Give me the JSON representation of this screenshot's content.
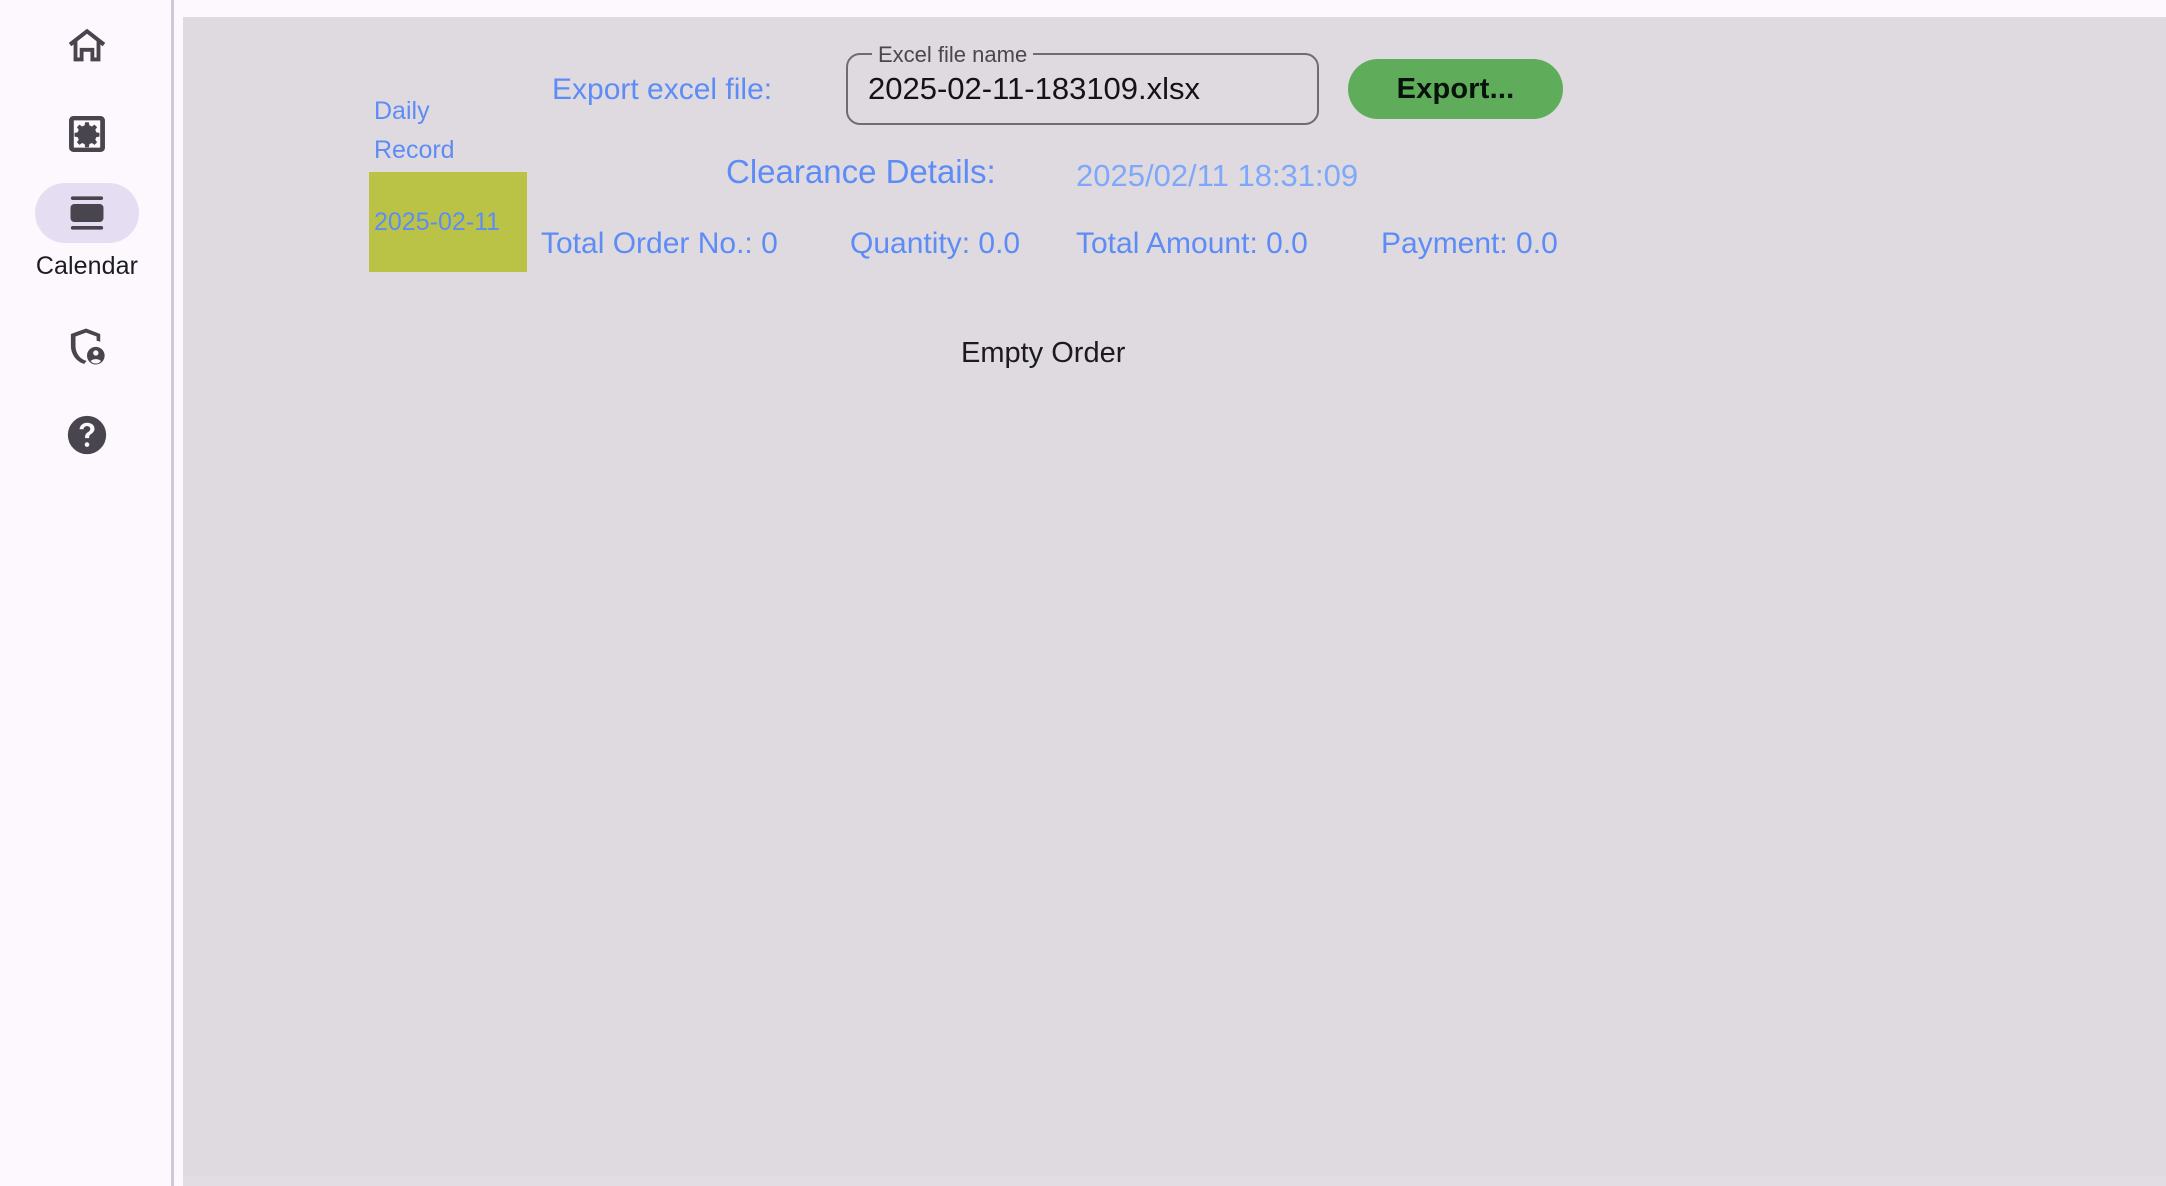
{
  "sidebar": {
    "items": [
      {
        "id": "home",
        "icon": "home-icon",
        "label": "",
        "active": false
      },
      {
        "id": "settings",
        "icon": "settings-icon",
        "label": "",
        "active": false
      },
      {
        "id": "calendar",
        "icon": "calendar-icon",
        "label": "Calendar",
        "active": true
      },
      {
        "id": "admin",
        "icon": "shield-person-icon",
        "label": "",
        "active": false
      },
      {
        "id": "help",
        "icon": "help-icon",
        "label": "",
        "active": false
      }
    ]
  },
  "toolbar": {
    "export_label": "Export excel file:",
    "field_label": "Excel file name",
    "field_value": "2025-02-11-183109.xlsx",
    "field_placeholder": "Excel file name",
    "export_button": "Export..."
  },
  "daily_record": {
    "title": "Daily Record",
    "selected_date": "2025-02-11"
  },
  "clearance": {
    "title": "Clearance Details:",
    "timestamp": "2025/02/11 18:31:09",
    "total_order_no": "Total Order No.: 0",
    "quantity": "Quantity: 0.0",
    "total_amount": "Total Amount: 0.0",
    "payment": "Payment: 0.0"
  },
  "orders": {
    "empty_text": "Empty Order"
  },
  "colors": {
    "accent_blue": "#5e8cf7",
    "export_green": "#5fac5b",
    "date_chip": "#bbc347",
    "panel_bg": "#dedadf",
    "sidebar_bg": "#fcf8fd",
    "active_pill": "#e5def2"
  }
}
